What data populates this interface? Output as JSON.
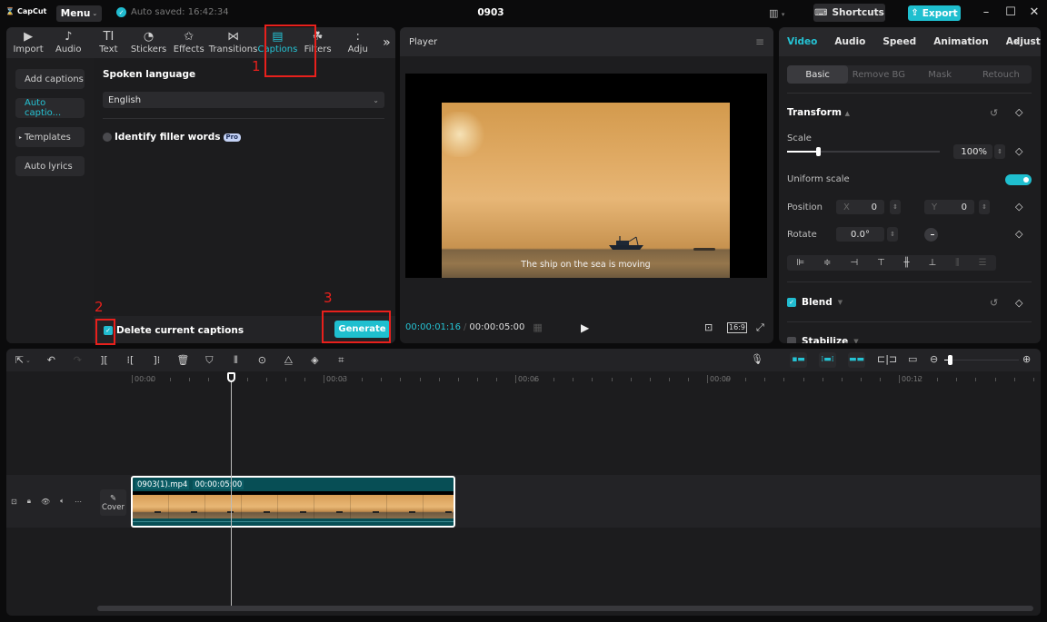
{
  "titlebar": {
    "app_name": "CapCut",
    "menu_label": "Menu",
    "autosave_text": "Auto saved: 16:42:34",
    "project_title": "0903",
    "shortcuts_label": "Shortcuts",
    "export_label": "Export",
    "window_controls": [
      "minimize",
      "maximize",
      "close"
    ]
  },
  "media_toolbar": {
    "tools": [
      {
        "label": "Import",
        "icon": "import-icon",
        "glyph": "▶"
      },
      {
        "label": "Audio",
        "icon": "audio-icon",
        "glyph": "♪"
      },
      {
        "label": "Text",
        "icon": "text-icon",
        "glyph": "TI"
      },
      {
        "label": "Stickers",
        "icon": "sticker-icon",
        "glyph": "◔"
      },
      {
        "label": "Effects",
        "icon": "effects-icon",
        "glyph": "✩"
      },
      {
        "label": "Transitions",
        "icon": "transitions-icon",
        "glyph": "⋈"
      },
      {
        "label": "Captions",
        "icon": "captions-icon",
        "glyph": "▤",
        "active": true
      },
      {
        "label": "Filters",
        "icon": "filters-icon",
        "glyph": "☘"
      },
      {
        "label": "Adju",
        "icon": "adjustment-icon",
        "glyph": ":"
      }
    ],
    "more_glyph": "»"
  },
  "captions_nav": {
    "items": [
      {
        "label": "Add captions"
      },
      {
        "label": "Auto captio...",
        "active": true
      },
      {
        "label": "Templates",
        "prefix": "▸"
      },
      {
        "label": "Auto lyrics"
      }
    ]
  },
  "captions_panel": {
    "spoken_language_label": "Spoken language",
    "language_value": "English",
    "filler_words_label": "Identify filler words",
    "pro_badge": "Pro",
    "delete_captions_label": "Delete current captions",
    "delete_captions_checked": true,
    "generate_label": "Generate"
  },
  "annotations": [
    {
      "number": "1",
      "target": "Captions tab"
    },
    {
      "number": "2",
      "target": "Delete current captions checkbox"
    },
    {
      "number": "3",
      "target": "Generate button"
    }
  ],
  "player": {
    "title": "Player",
    "subtitle_text": "The ship on the sea is moving",
    "current_time": "00:00:01:16",
    "total_time": "00:00:05:00",
    "ratio_label": "16:9"
  },
  "inspector": {
    "tabs": [
      "Video",
      "Audio",
      "Speed",
      "Animation",
      "Adjustment"
    ],
    "active_tab": "Video",
    "subtabs": [
      "Basic",
      "Remove BG",
      "Mask",
      "Retouch"
    ],
    "active_subtab": "Basic",
    "transform_label": "Transform",
    "scale_label": "Scale",
    "scale_value": "100%",
    "scale_slider_fraction": 0.2,
    "uniform_scale_label": "Uniform scale",
    "uniform_scale_on": true,
    "position_label": "Position",
    "x_label": "X",
    "x_value": "0",
    "y_label": "Y",
    "y_value": "0",
    "rotate_label": "Rotate",
    "rotate_value": "0.0°",
    "blend_label": "Blend",
    "blend_checked": true,
    "stabilize_label": "Stabilize",
    "stabilize_checked": false
  },
  "timeline": {
    "ruler_labels": [
      "00:00",
      "00:03",
      "00:06",
      "00:09",
      "00:12"
    ],
    "clip_name": "0903(1).mp4",
    "clip_duration": "00:00:05:00",
    "cover_label": "Cover",
    "zoom_fraction": 0.05
  },
  "colors": {
    "accent": "#1fbfcf",
    "annotation_red": "#e8201c",
    "panel_bg": "#1d1d1f",
    "clip_bg": "#074e55"
  }
}
